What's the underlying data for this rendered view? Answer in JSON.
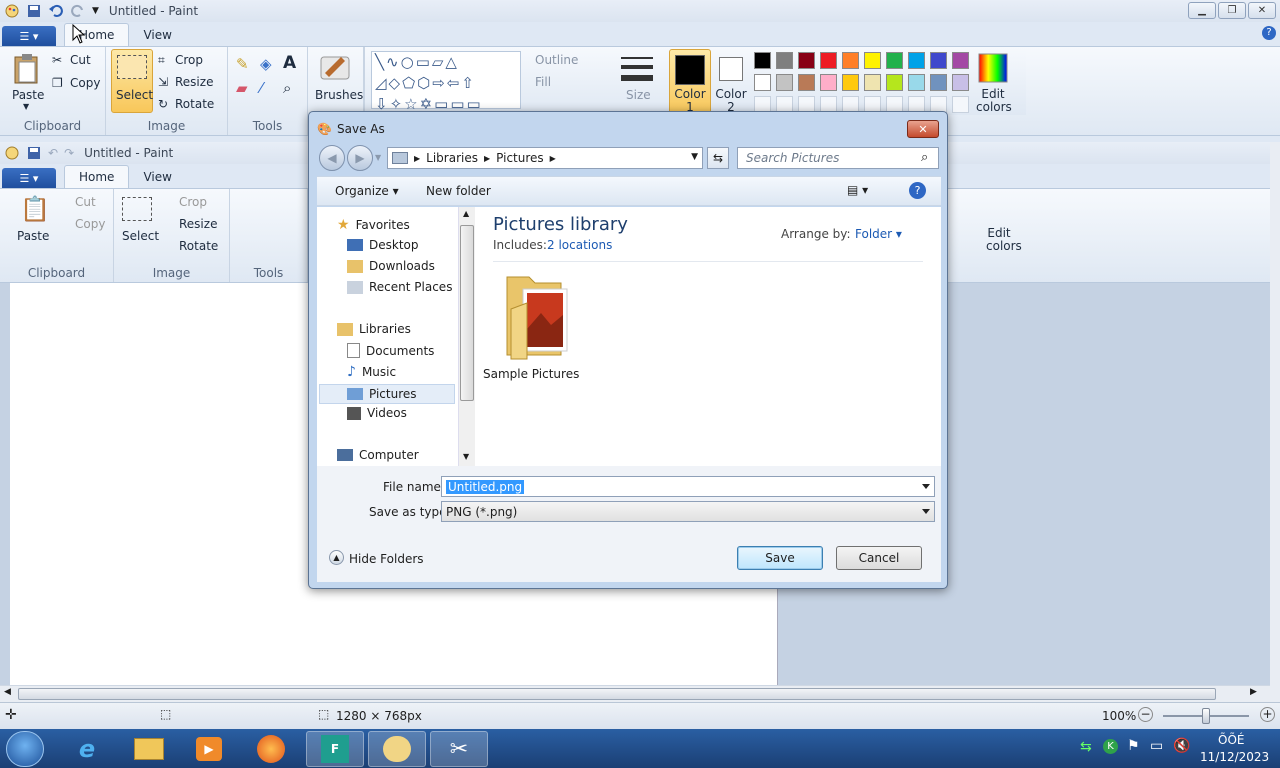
{
  "outer_window": {
    "title": "Untitled - Paint",
    "tabs": [
      "Home",
      "View"
    ],
    "clipboard": {
      "paste": "Paste",
      "cut": "Cut",
      "copy": "Copy",
      "group": "Clipboard"
    },
    "image": {
      "select": "Select",
      "crop": "Crop",
      "resize": "Resize",
      "rotate": "Rotate",
      "group": "Image"
    },
    "tools_group": "Tools",
    "brushes": "Brushes",
    "shapes": {
      "outline": "Outline",
      "fill": "Fill"
    },
    "size": "Size",
    "color1": "Color 1",
    "color2": "Color 2",
    "edit_colors": "Edit colors",
    "palette_row1": [
      "#000000",
      "#7f7f7f",
      "#880015",
      "#ed1c24",
      "#ff7f27",
      "#fff200",
      "#22b14c",
      "#00a2e8",
      "#3f48cc",
      "#a349a4"
    ],
    "palette_row2": [
      "#ffffff",
      "#c3c3c3",
      "#b97a57",
      "#ffaec9",
      "#ffc90e",
      "#efe4b0",
      "#b5e61d",
      "#99d9ea",
      "#7092be",
      "#c8bfe7"
    ]
  },
  "inner_window": {
    "title": "Untitled - Paint",
    "tabs": [
      "Home",
      "View"
    ],
    "clipboard": {
      "paste": "Paste",
      "cut": "Cut",
      "copy": "Copy",
      "group": "Clipboard"
    },
    "image": {
      "select": "Select",
      "crop": "Crop",
      "resize": "Resize",
      "rotate": "Rotate",
      "group": "Image"
    },
    "tools_group": "Tools",
    "edit_colors": "Edit colors"
  },
  "statusbar": {
    "dimensions": "1280 × 768px",
    "zoom": "100%"
  },
  "taskbar": {
    "clock_time": "ÕÕÉ",
    "clock_date": "11/12/2023"
  },
  "dialog": {
    "title": "Save As",
    "breadcrumb": [
      "Libraries",
      "Pictures"
    ],
    "search_placeholder": "Search Pictures",
    "organize": "Organize",
    "new_folder": "New folder",
    "nav": {
      "favorites": "Favorites",
      "desktop": "Desktop",
      "downloads": "Downloads",
      "recent": "Recent Places",
      "libraries": "Libraries",
      "documents": "Documents",
      "music": "Music",
      "pictures": "Pictures",
      "videos": "Videos",
      "computer": "Computer"
    },
    "library_title": "Pictures library",
    "includes_label": "Includes:",
    "includes_link": "2 locations",
    "arrange_label": "Arrange by:",
    "arrange_value": "Folder",
    "folder_name": "Sample Pictures",
    "file_name_label": "File name:",
    "file_name_value": "Untitled.png",
    "save_type_label": "Save as type:",
    "save_type_value": "PNG (*.png)",
    "hide_folders": "Hide Folders",
    "save": "Save",
    "cancel": "Cancel"
  }
}
